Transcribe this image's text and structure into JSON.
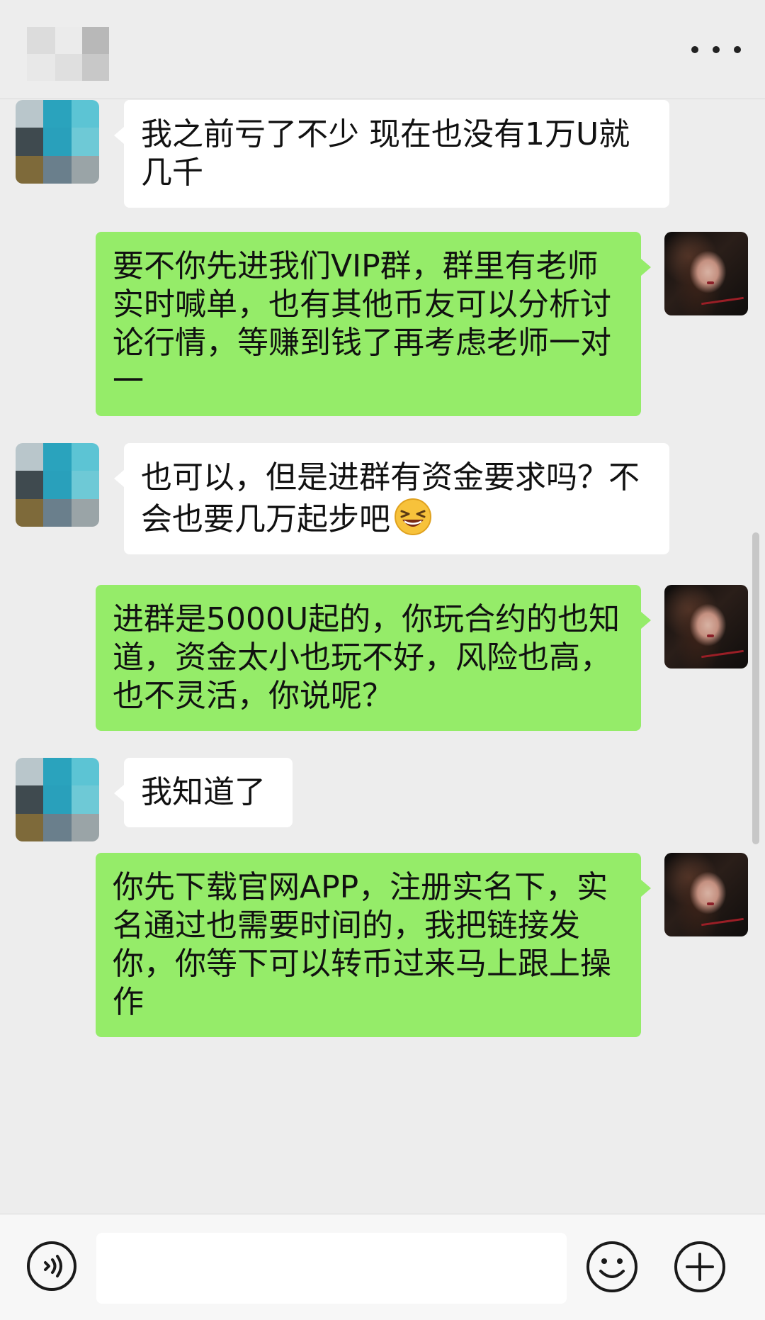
{
  "header": {
    "title_icon": "pixelated-contact-name",
    "more_icon": "more-dots-icon"
  },
  "colors": {
    "background": "#ededed",
    "incoming_bubble": "#ffffff",
    "outgoing_bubble": "#95ec69"
  },
  "messages": [
    {
      "direction": "in",
      "text": "我之前亏了不少  现在也没有1万U就几千"
    },
    {
      "direction": "out",
      "text": "要不你先进我们VIP群，群里有老师实时喊单，也有其他币友可以分析讨论行情，等赚到钱了再考虑老师一对一"
    },
    {
      "direction": "in",
      "text": "也可以，但是进群有资金要求吗？不会也要几万起步吧",
      "emoji": "grinning-squinting-face-emoji"
    },
    {
      "direction": "out",
      "text": "进群是5000U起的，你玩合约的也知道，资金太小也玩不好，风险也高，也不灵活，你说呢？"
    },
    {
      "direction": "in",
      "text": "我知道了"
    },
    {
      "direction": "out",
      "text": "你先下载官网APP，注册实名下，实名通过也需要时间的，我把链接发你，你等下可以转币过来马上跟上操作"
    }
  ],
  "composer": {
    "value": "",
    "voice_icon": "voice-input-icon",
    "emoji_icon": "emoji-icon",
    "plus_icon": "plus-icon"
  }
}
